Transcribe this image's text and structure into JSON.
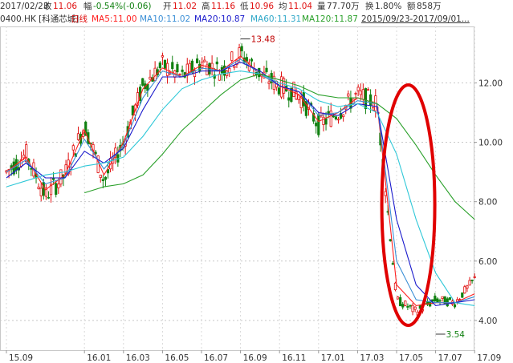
{
  "header": {
    "date": "2017/02/23",
    "close_label": "收",
    "close": "11.06",
    "change_label": "幅",
    "change": "-0.54%(-0.06)",
    "open_label": "开",
    "open": "11.02",
    "high_label": "高",
    "high": "11.16",
    "low_label": "低",
    "low": "10.96",
    "avg_label": "均",
    "avg": "11.04",
    "volume_label": "量",
    "volume": "77.70万",
    "turnover_label": "换",
    "turnover": "1.80%",
    "amount_label": "额",
    "amount": "858万"
  },
  "legend": {
    "code": "0400.HK [科通芯城]",
    "period": "日线",
    "ma5": "MA5:11.00",
    "ma10": "MA10:11.02",
    "ma20": "MA20:10.87",
    "ma60": "MA60:11.31",
    "ma120": "MA120:11.87",
    "range": "2015/09/23-2017/09/01..."
  },
  "colors": {
    "up": "#e01010",
    "down": "#108010",
    "ma5": "#ff2020",
    "ma10": "#3b8fd6",
    "ma20": "#1a1acc",
    "ma60": "#30c8d8",
    "ma120": "#2aa02a",
    "highlight": "#e00000"
  },
  "chart_data": {
    "type": "candlestick",
    "title": "0400.HK [科通芯城] 日线",
    "x_tick_labels": [
      "15.09",
      "16.01",
      "16.03",
      "16.05",
      "16.07",
      "16.09",
      "16.11",
      "17.01",
      "17.03",
      "17.05",
      "17.07",
      "17.09"
    ],
    "y_tick_labels": [
      "4.00",
      "6.00",
      "8.00",
      "10.00",
      "12.00"
    ],
    "ylim": [
      3.0,
      13.9
    ],
    "max_marker": {
      "label": "13.48",
      "value": 13.48,
      "month": "16.09"
    },
    "min_marker": {
      "label": "3.54",
      "value": 3.54,
      "month": "17.07"
    },
    "close_path": [
      [
        "15.09",
        9.0
      ],
      [
        "15.10",
        9.6
      ],
      [
        "15.11",
        8.2
      ],
      [
        "15.12",
        8.9
      ],
      [
        "16.01",
        10.6
      ],
      [
        "16.02",
        8.7
      ],
      [
        "16.03",
        10.0
      ],
      [
        "16.04",
        11.9
      ],
      [
        "16.05",
        12.6
      ],
      [
        "16.06",
        12.2
      ],
      [
        "16.07",
        12.7
      ],
      [
        "16.08",
        12.4
      ],
      [
        "16.09",
        13.0
      ],
      [
        "16.10",
        12.3
      ],
      [
        "16.11",
        11.9
      ],
      [
        "16.12",
        11.6
      ],
      [
        "17.01",
        10.6
      ],
      [
        "17.02",
        11.0
      ],
      [
        "17.03",
        11.6
      ],
      [
        "17.04",
        11.3
      ],
      [
        "17.05",
        4.7
      ],
      [
        "17.06",
        4.3
      ],
      [
        "17.07",
        4.7
      ],
      [
        "17.08",
        4.6
      ],
      [
        "17.09",
        5.4
      ]
    ],
    "series": [
      {
        "name": "MA5",
        "values": [
          9.0,
          9.5,
          8.4,
          8.9,
          10.4,
          8.9,
          10.0,
          11.8,
          12.5,
          12.2,
          12.6,
          12.4,
          12.9,
          12.3,
          11.9,
          11.6,
          10.7,
          11.0,
          11.5,
          11.3,
          5.2,
          4.5,
          4.6,
          4.6,
          4.9
        ]
      },
      {
        "name": "MA10",
        "values": [
          9.0,
          9.4,
          8.6,
          8.8,
          10.1,
          9.1,
          9.9,
          11.5,
          12.4,
          12.2,
          12.5,
          12.4,
          12.8,
          12.3,
          11.9,
          11.7,
          10.9,
          11.0,
          11.4,
          11.3,
          6.0,
          4.7,
          4.6,
          4.6,
          4.8
        ]
      },
      {
        "name": "MA20",
        "values": [
          8.8,
          9.3,
          8.8,
          8.8,
          9.7,
          9.3,
          9.8,
          11.1,
          12.2,
          12.2,
          12.4,
          12.4,
          12.7,
          12.4,
          11.9,
          11.7,
          11.0,
          10.9,
          11.3,
          11.2,
          7.4,
          5.2,
          4.5,
          4.6,
          4.7
        ]
      },
      {
        "name": "MA60",
        "values": [
          8.5,
          8.7,
          8.9,
          9.0,
          9.2,
          9.3,
          9.5,
          10.2,
          11.1,
          11.8,
          12.1,
          12.3,
          12.4,
          12.3,
          12.0,
          11.8,
          11.4,
          11.2,
          11.3,
          11.0,
          9.6,
          7.4,
          5.6,
          4.6,
          4.5
        ]
      },
      {
        "name": "MA120",
        "values": [
          null,
          null,
          null,
          null,
          8.3,
          8.5,
          8.6,
          8.9,
          9.6,
          10.4,
          11.0,
          11.6,
          12.1,
          12.3,
          12.1,
          11.9,
          11.6,
          11.5,
          11.5,
          11.3,
          10.8,
          9.9,
          8.9,
          8.0,
          7.4
        ]
      }
    ]
  }
}
